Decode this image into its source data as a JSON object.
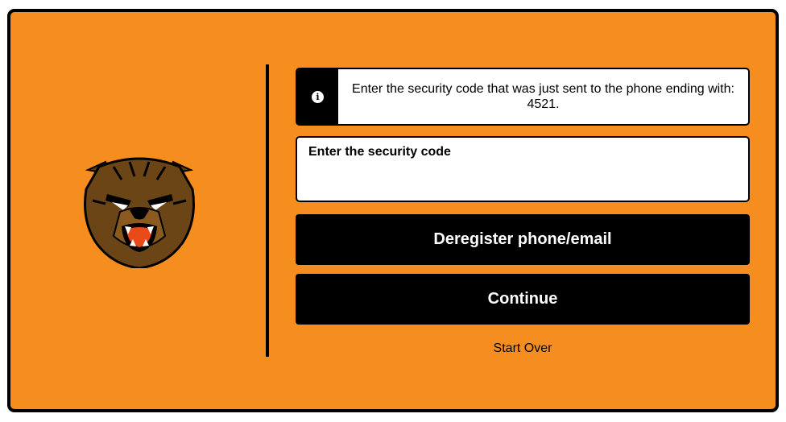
{
  "notice": {
    "icon": "info-icon",
    "text": "Enter the security code that was just sent to the phone ending with: 4521."
  },
  "security_code": {
    "label": "Enter the security code",
    "value": "",
    "placeholder": ""
  },
  "buttons": {
    "deregister": "Deregister phone/email",
    "continue": "Continue"
  },
  "links": {
    "start_over": "Start Over"
  },
  "logo": {
    "icon": "bear-mascot-logo"
  },
  "colors": {
    "background": "#f68d1f",
    "button": "#000000",
    "button_text": "#ffffff"
  }
}
